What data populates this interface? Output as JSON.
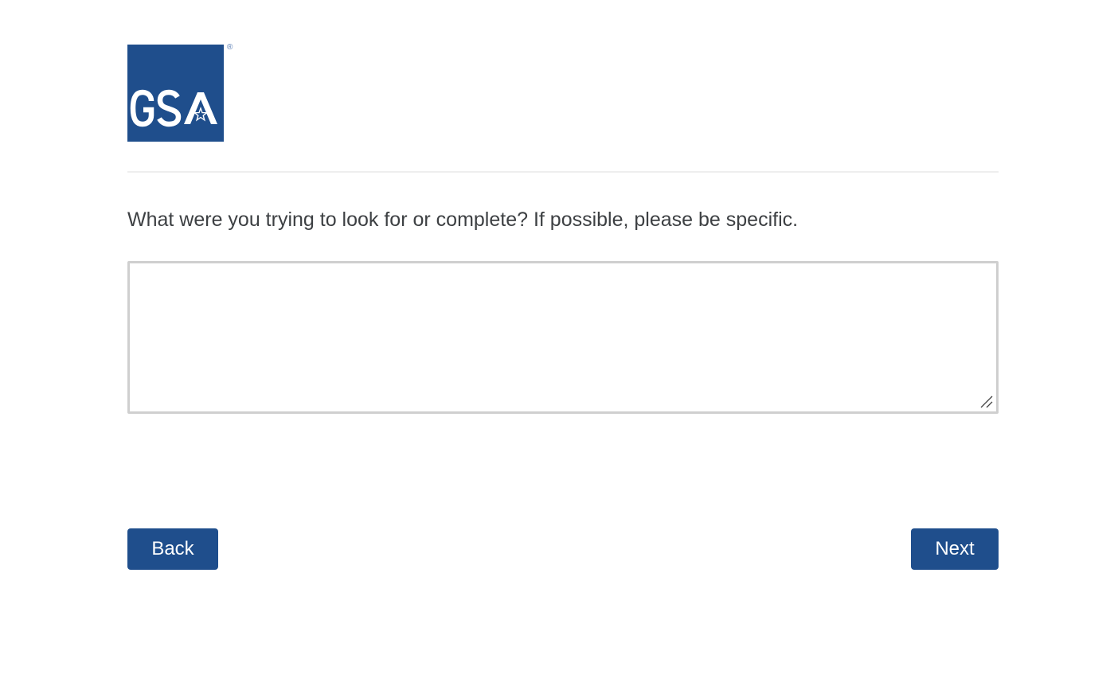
{
  "header": {
    "logo_text": "GSA",
    "logo_registered_mark": "®",
    "logo_color": "#1f4e8c"
  },
  "question": {
    "text": "What were you trying to look for or complete? If possible, please be specific."
  },
  "answer": {
    "value": "",
    "placeholder": ""
  },
  "navigation": {
    "back_label": "Back",
    "next_label": "Next",
    "button_color": "#1f4e8c"
  },
  "icons": {
    "resize": "resize-handle-icon"
  }
}
